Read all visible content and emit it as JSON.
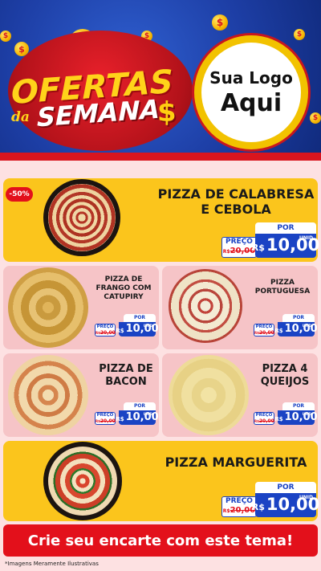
{
  "header": {
    "promo_line1": "OFERTAS",
    "promo_da": "da",
    "promo_line2": "SEMANA",
    "promo_dollar": "$",
    "coin_symbol": "$",
    "logo_line1": "Sua Logo",
    "logo_line2": "Aqui"
  },
  "colors": {
    "header_blue": "#1d3ea5",
    "brand_red": "#e3101b",
    "card_yellow": "#fbc51c",
    "card_pink": "#f6c4c7",
    "price_blue": "#1a43c4"
  },
  "products": [
    {
      "name": "PIZZA DE CALABRESA E CEBOLA",
      "badge": "-50%",
      "por": "POR",
      "preco_label": "PREÇO",
      "old_prefix": "R$",
      "old_price": "20,00",
      "currency": "R$",
      "price": "10,00",
      "unit": "UNID"
    },
    {
      "name": "PIZZA DE FRANGO COM CATUPIRY",
      "por": "POR",
      "preco_label": "PREÇO",
      "old_prefix": "R$",
      "old_price": "20,00",
      "currency": "R$",
      "price": "10,00",
      "unit": "UNID"
    },
    {
      "name": "PIZZA PORTUGUESA",
      "por": "POR",
      "preco_label": "PREÇO",
      "old_prefix": "R$",
      "old_price": "20,00",
      "currency": "R$",
      "price": "10,00",
      "unit": "UNID"
    },
    {
      "name": "PIZZA DE BACON",
      "por": "POR",
      "preco_label": "PREÇO",
      "old_prefix": "R$",
      "old_price": "20,00",
      "currency": "R$",
      "price": "10,00",
      "unit": "UNID"
    },
    {
      "name": "PIZZA 4 QUEIJOS",
      "por": "POR",
      "preco_label": "PREÇO",
      "old_prefix": "R$",
      "old_price": "20,00",
      "currency": "R$",
      "price": "10,00",
      "unit": "UNID"
    },
    {
      "name": "PIZZA MARGUERITA",
      "por": "POR",
      "preco_label": "PREÇO",
      "old_prefix": "R$",
      "old_price": "20,00",
      "currency": "R$",
      "price": "10,00",
      "unit": "UNID"
    }
  ],
  "cta": "Crie seu encarte com este tema!",
  "footnote": "*Imagens Meramente Ilustrativas"
}
